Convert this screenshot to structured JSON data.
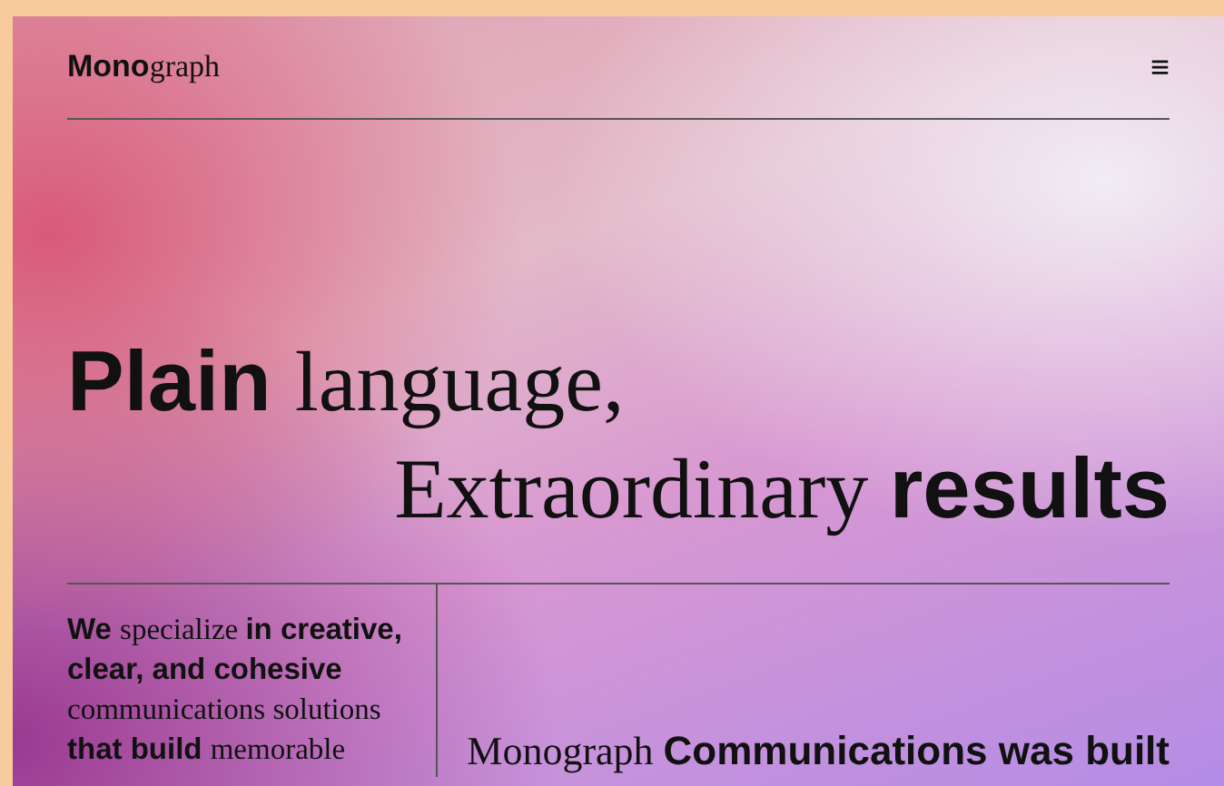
{
  "header": {
    "logo": [
      {
        "text": "Mono",
        "kind": "sans"
      },
      {
        "text": "graph",
        "kind": "serif"
      }
    ],
    "menu_icon": "≡"
  },
  "hero": {
    "line_1": [
      {
        "text": "Plain ",
        "kind": "sans"
      },
      {
        "text": "language,",
        "kind": "serif"
      }
    ],
    "line_2": [
      {
        "text": "Extraordinary ",
        "kind": "serif"
      },
      {
        "text": "results",
        "kind": "sans"
      }
    ]
  },
  "intro": [
    {
      "text": "We ",
      "kind": "sans"
    },
    {
      "text": "specialize ",
      "kind": "serif"
    },
    {
      "text": "in creative, clear, and cohesive ",
      "kind": "sans"
    },
    {
      "text": "communications solutions ",
      "kind": "serif"
    },
    {
      "text": "that build ",
      "kind": "sans"
    },
    {
      "text": "memorable",
      "kind": "serif"
    }
  ],
  "statement": [
    {
      "text": "Monograph ",
      "kind": "serif"
    },
    {
      "text": "Communications was built",
      "kind": "sans"
    }
  ]
}
